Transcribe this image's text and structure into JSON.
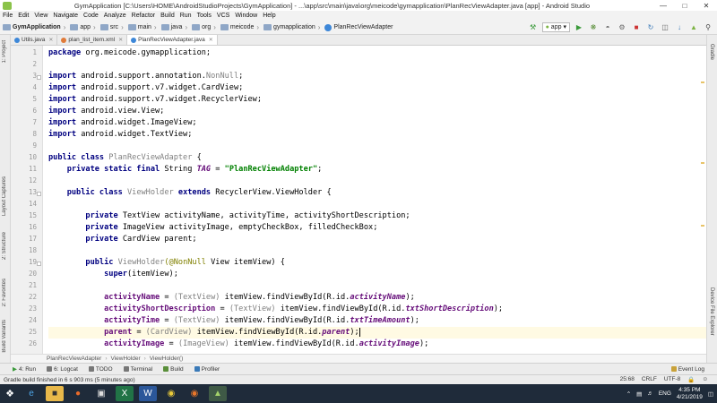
{
  "window": {
    "title": "GymApplication [C:\\Users\\HOME\\AndroidStudioProjects\\GymApplication] - ...\\app\\src\\main\\java\\org\\meicode\\gymapplication\\PlanRecViewAdapter.java [app] - Android Studio"
  },
  "menu": [
    "File",
    "Edit",
    "View",
    "Navigate",
    "Code",
    "Analyze",
    "Refactor",
    "Build",
    "Run",
    "Tools",
    "VCS",
    "Window",
    "Help"
  ],
  "navbar": {
    "crumbs": [
      "GymApplication",
      "app",
      "src",
      "main",
      "java",
      "org",
      "meicode",
      "gymapplication",
      "PlanRecViewAdapter"
    ],
    "run_config": "app"
  },
  "tabs": [
    {
      "label": "Utils.java",
      "color": "#3d87d8"
    },
    {
      "label": "plan_list_item.xml",
      "color": "#e07b39"
    },
    {
      "label": "PlanRecViewAdapter.java",
      "color": "#3d87d8",
      "active": true
    }
  ],
  "left_tools": [
    "1: Project",
    "Layout Captures",
    "2: Structure",
    "2: Favorites",
    "Build Variants"
  ],
  "right_tools": [
    "Gradle",
    "Device File Explorer"
  ],
  "code": {
    "line_numbers": [
      "1",
      "2",
      "3",
      "4",
      "5",
      "6",
      "7",
      "8",
      "9",
      "10",
      "11",
      "12",
      "13",
      "14",
      "15",
      "16",
      "17",
      "18",
      "19",
      "20",
      "21",
      "22",
      "23",
      "24",
      "25",
      "26"
    ],
    "l1": {
      "kw": "package",
      "rest": " org.meicode.gymapplication;"
    },
    "l3": {
      "kw": "import",
      "rest": " android.support.annotation.",
      "dim": "NonNull",
      "end": ";"
    },
    "l4": {
      "kw": "import",
      "rest": " android.support.v7.widget.CardView;"
    },
    "l5": {
      "kw": "import",
      "rest": " android.support.v7.widget.RecyclerView;"
    },
    "l6": {
      "kw": "import",
      "rest": " android.view.View;"
    },
    "l7": {
      "kw": "import",
      "rest": " android.widget.ImageView;"
    },
    "l8": {
      "kw": "import",
      "rest": " android.widget.TextView;"
    },
    "l10": {
      "kw": "public class ",
      "name": "PlanRecViewAdapter",
      "rest": " {"
    },
    "l11": {
      "kw": "private static final ",
      "type": "String ",
      "field": "TAG",
      "eq": " = ",
      "str": "\"PlanRecViewAdapter\"",
      "end": ";"
    },
    "l13": {
      "kw": "public class ",
      "name": "ViewHolder",
      "kw2": " extends ",
      "rest": "RecyclerView.ViewHolder {"
    },
    "l15": {
      "kw": "private ",
      "rest": "TextView activityName, activityTime, activityShortDescription;"
    },
    "l16": {
      "kw": "private ",
      "rest": "ImageView activityImage, emptyCheckBox, filledCheckBox;"
    },
    "l17": {
      "kw": "private ",
      "rest": "CardView parent;"
    },
    "l19": {
      "kw": "public ",
      "name": "ViewHolder",
      "ann": "(@NonNull",
      "rest": " View itemView) {"
    },
    "l20": {
      "kw": "super",
      "rest": "(itemView);"
    },
    "l22": {
      "field": "activityName",
      "eq": " = ",
      "cast": "(TextView)",
      "call": " itemView.findViewById(R.id.",
      "id": "activityName",
      "end": ");"
    },
    "l23": {
      "field": "activityShortDescription",
      "eq": " = ",
      "cast": "(TextView)",
      "call": " itemView.findViewById(R.id.",
      "id": "txtShortDescription",
      "end": ");"
    },
    "l24": {
      "field": "activityTime",
      "eq": " = ",
      "cast": "(TextView)",
      "call": " itemView.findViewById(R.id.",
      "id": "txtTimeAmount",
      "end": ");"
    },
    "l25": {
      "field": "parent",
      "eq": " = ",
      "cast": "(CardView)",
      "call": " itemView.findViewById(R.id.",
      "id": "parent",
      "end": ");"
    },
    "l26": {
      "field": "activityImage",
      "eq": " = ",
      "cast": "(ImageView)",
      "call": " itemView.findViewById(R.id.",
      "id": "activityImage",
      "end": ");"
    }
  },
  "breadcrumb": [
    "PlanRecViewAdapter",
    "ViewHolder",
    "ViewHolder()"
  ],
  "bottom_tools": [
    "4: Run",
    "6: Logcat",
    "TODO",
    "Terminal",
    "Build",
    "Profiler"
  ],
  "event_log": "Event Log",
  "status": {
    "message": "Gradle build finished in 6 s 903 ms (5 minutes ago)",
    "position": "25:68",
    "line_sep": "CRLF",
    "encoding": "UTF-8"
  },
  "taskbar": {
    "lang": "ENG",
    "time": "4:35 PM",
    "date": "4/21/2019"
  }
}
